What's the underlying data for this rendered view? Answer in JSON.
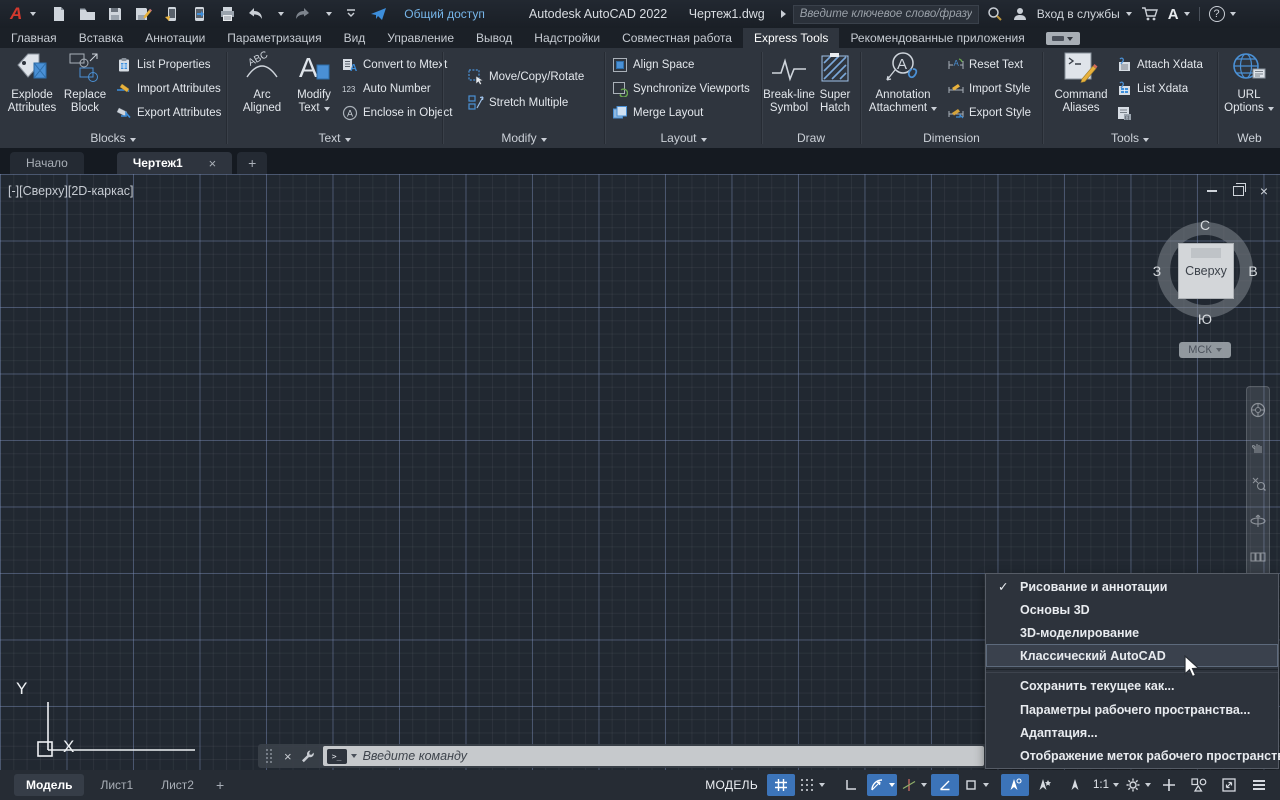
{
  "glyphs": {
    "check": "✓",
    "close": "×",
    "question": "?",
    "autodesk": "A",
    "prompt": ">_"
  },
  "titlebar": {
    "logo": "A",
    "share_label": "Общий доступ",
    "app_title": "Autodesk AutoCAD 2022",
    "doc_title": "Чертеж1.dwg",
    "search_placeholder": "Введите ключевое слово/фразу",
    "sign_in_label": "Вход в службы"
  },
  "menu": {
    "tabs": [
      "Главная",
      "Вставка",
      "Аннотации",
      "Параметризация",
      "Вид",
      "Управление",
      "Вывод",
      "Надстройки",
      "Совместная работа",
      "Express Tools",
      "Рекомендованные приложения"
    ]
  },
  "ribbon": {
    "panels": [
      {
        "title": "Blocks",
        "big": [
          {
            "l1": "Explode",
            "l2": "Attributes"
          },
          {
            "l1": "Replace",
            "l2": "Block"
          }
        ],
        "small": [
          {
            "label": "List Properties"
          },
          {
            "label": "Import Attributes"
          },
          {
            "label": "Export Attributes"
          }
        ]
      },
      {
        "title": "Text",
        "big": [
          {
            "l1": "Arc",
            "l2": "Aligned"
          },
          {
            "l1": "Modify",
            "l2": "Text"
          }
        ],
        "small": [
          {
            "label": "Convert to Mtext"
          },
          {
            "label": "Auto Number"
          },
          {
            "label": "Enclose in Object"
          }
        ]
      },
      {
        "title": "Modify",
        "small": [
          {
            "label": "Move/Copy/Rotate"
          },
          {
            "label": "Stretch Multiple"
          }
        ]
      },
      {
        "title": "Layout",
        "small": [
          {
            "label": "Align Space"
          },
          {
            "label": "Synchronize Viewports"
          },
          {
            "label": "Merge Layout"
          }
        ]
      },
      {
        "title": "Draw",
        "big": [
          {
            "l1": "Break-line",
            "l2": "Symbol"
          },
          {
            "l1": "Super",
            "l2": "Hatch"
          }
        ]
      },
      {
        "title": "Dimension",
        "big": [
          {
            "l1": "Annotation",
            "l2": "Attachment"
          }
        ],
        "small": [
          {
            "label": "Reset Text"
          },
          {
            "label": "Import Style"
          },
          {
            "label": "Export Style"
          }
        ]
      },
      {
        "title": "Tools",
        "big": [
          {
            "l1": "Command",
            "l2": "Aliases"
          }
        ],
        "small": [
          {
            "label": "Attach Xdata"
          },
          {
            "label": "List Xdata"
          },
          {
            "label": ""
          }
        ]
      },
      {
        "title": "Web",
        "big": [
          {
            "l1": "URL",
            "l2": "Options"
          }
        ]
      }
    ]
  },
  "icons": {
    "abc": "ABC",
    "letter_a": "A",
    "auto_number": "123"
  },
  "file_tabs": {
    "start": "Начало",
    "drawing": "Чертеж1",
    "add": "+"
  },
  "viewport": {
    "controls_label": "[-][Сверху][2D-каркас]",
    "viewcube": {
      "n": "С",
      "e": "В",
      "s": "Ю",
      "w": "З",
      "face": "Сверху"
    },
    "wcs_label": "МСК",
    "ucs": {
      "x": "X",
      "y": "Y"
    }
  },
  "command": {
    "placeholder": "Введите  команду"
  },
  "workspace_menu": {
    "items": [
      {
        "label": "Рисование и аннотации",
        "checked": true
      },
      {
        "label": "Основы 3D"
      },
      {
        "label": "3D-моделирование"
      },
      {
        "label": "Классический AutoCAD",
        "highlighted": true
      },
      {
        "label": "Сохранить текущее как..."
      },
      {
        "label": "Параметры рабочего пространства..."
      },
      {
        "label": "Адаптация..."
      },
      {
        "label": "Отображение меток рабочего пространства"
      }
    ]
  },
  "status": {
    "model_tab": "Модель",
    "layout1": "Лист1",
    "layout2": "Лист2",
    "add": "+",
    "mode_label": "МОДЕЛЬ",
    "scale": "1:1"
  },
  "colors": {
    "accent_blue": "#3c74b9",
    "icon_blue": "#3d8edb",
    "logo_red": "#d3392e",
    "canvas_bg": "#212831"
  }
}
